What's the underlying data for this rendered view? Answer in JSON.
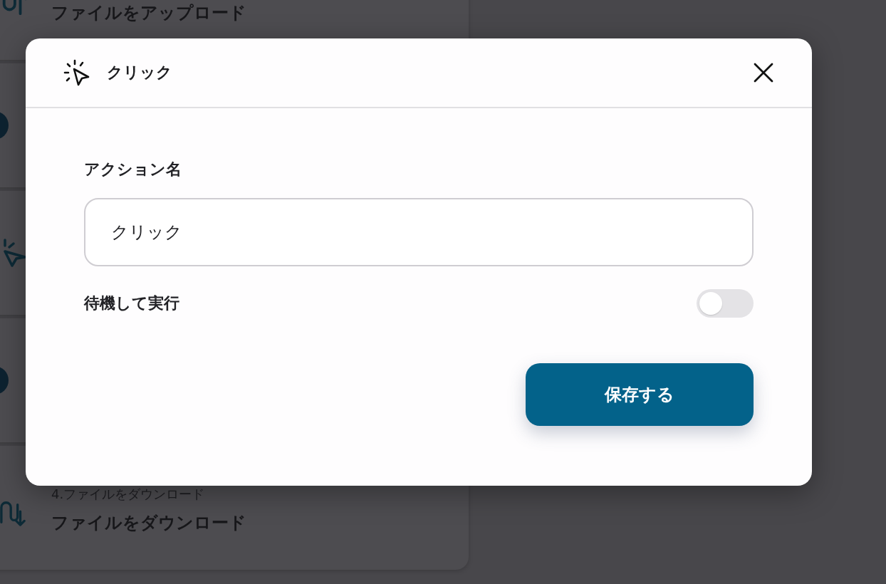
{
  "background_steps": [
    {
      "kind": "upload",
      "title": "ファイルをアップロード"
    },
    {
      "kind": "circle"
    },
    {
      "kind": "click"
    },
    {
      "kind": "circle"
    },
    {
      "kind": "download",
      "step_label": "4.ファイルをダウンロード",
      "title": "ファイルをダウンロード"
    }
  ],
  "dialog": {
    "title": "クリック",
    "fields": [
      {
        "kind": "text",
        "label": "アクション名",
        "value": "クリック"
      },
      {
        "kind": "toggle",
        "label": "待機して実行",
        "on": false
      }
    ],
    "save_button": "保存する"
  }
}
